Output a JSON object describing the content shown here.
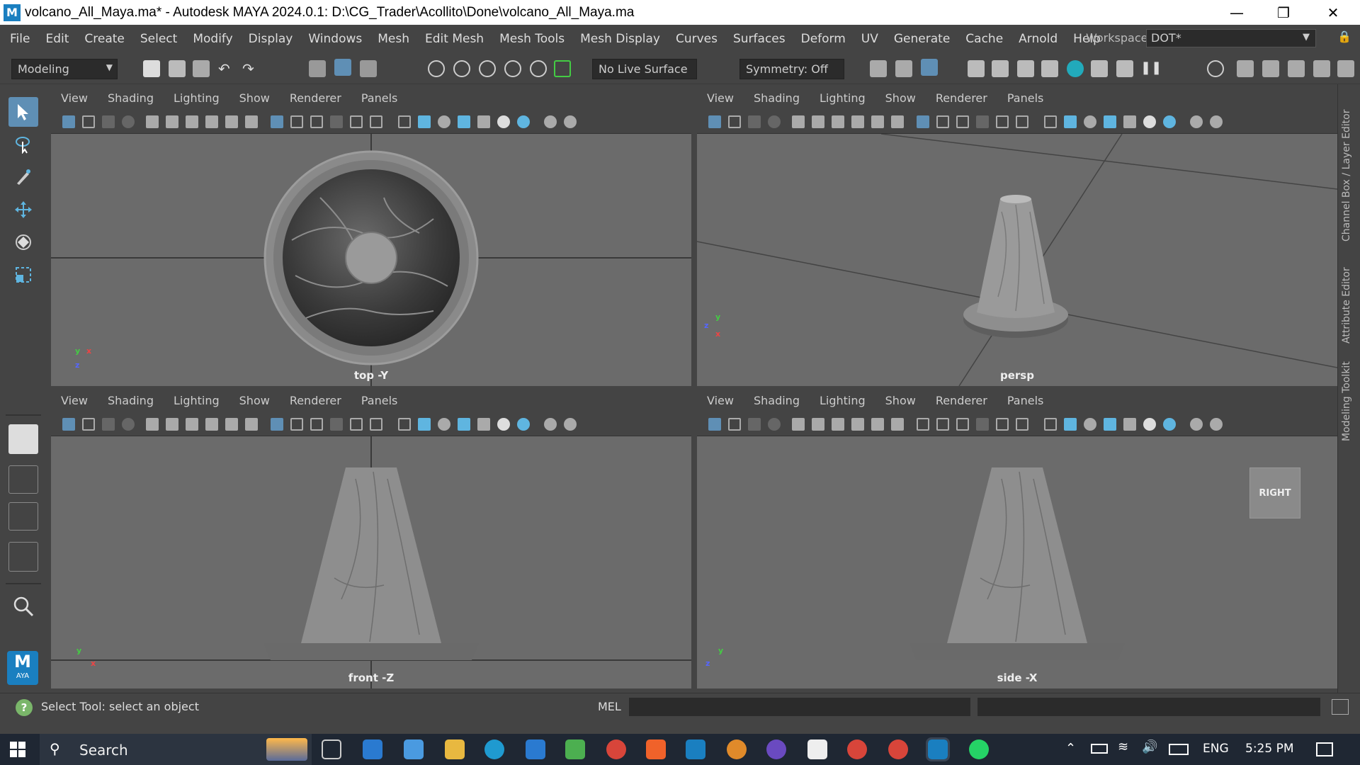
{
  "window": {
    "title": "volcano_All_Maya.ma* - Autodesk MAYA 2024.0.1: D:\\CG_Trader\\Acollito\\Done\\volcano_All_Maya.ma",
    "logo_letter": "M"
  },
  "menubar": {
    "items": [
      "File",
      "Edit",
      "Create",
      "Select",
      "Modify",
      "Display",
      "Windows",
      "Mesh",
      "Edit Mesh",
      "Mesh Tools",
      "Mesh Display",
      "Curves",
      "Surfaces",
      "Deform",
      "UV",
      "Generate",
      "Cache",
      "Arnold",
      "Help"
    ],
    "workspace_label": "Workspace:",
    "workspace_value": "DOT*"
  },
  "shelf": {
    "mode": "Modeling",
    "live_surface": "No Live Surface",
    "symmetry": "Symmetry: Off"
  },
  "viewport_menu": [
    "View",
    "Shading",
    "Lighting",
    "Show",
    "Renderer",
    "Panels"
  ],
  "viewports": {
    "top": {
      "label": "top -Y"
    },
    "persp": {
      "label": "persp"
    },
    "front": {
      "label": "front -Z"
    },
    "side": {
      "label": "side -X",
      "cube": "RIGHT"
    }
  },
  "axes": {
    "x": "x",
    "y": "y",
    "z": "z"
  },
  "right_tabs": [
    "Channel Box / Layer Editor",
    "Attribute Editor",
    "Modeling Toolkit"
  ],
  "status": {
    "message": "Select Tool: select an object",
    "lang": "MEL"
  },
  "toolbox": {
    "badge_letter": "M",
    "badge_sub": "AYA"
  },
  "taskbar": {
    "search": "Search",
    "lang": "ENG",
    "time": "5:25 PM"
  },
  "colors": {
    "maya_blue": "#1a7fc0",
    "viewport_bg": "#6b6b6b",
    "ui_bg": "#444444"
  }
}
